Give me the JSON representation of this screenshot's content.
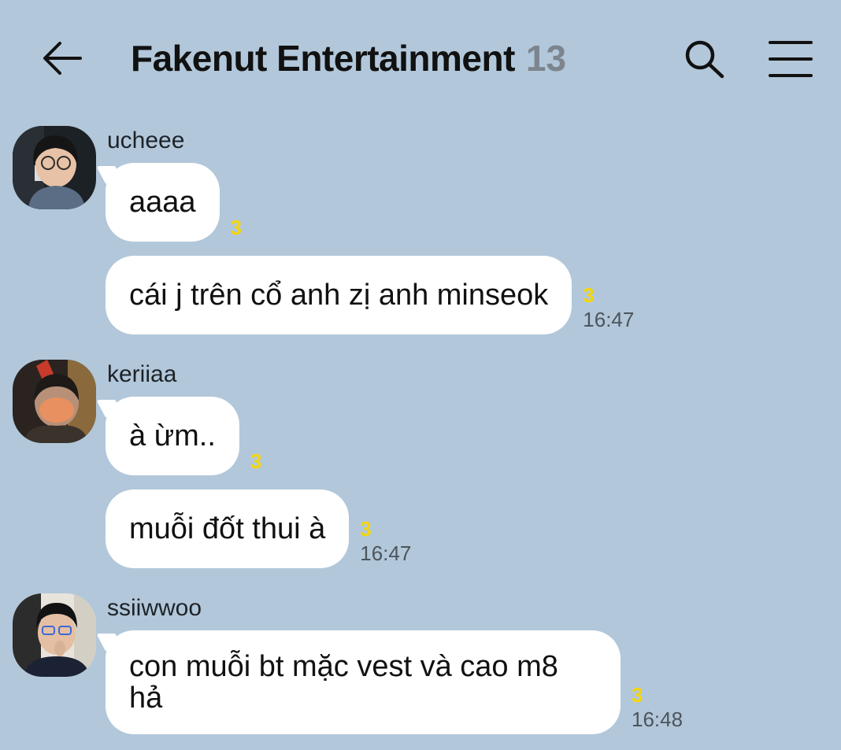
{
  "header": {
    "title": "Fakenut Entertainment",
    "member_count": "13"
  },
  "icons": {
    "back": "back-arrow-icon",
    "search": "search-icon",
    "menu": "menu-icon"
  },
  "colors": {
    "background": "#b2c7da",
    "bubble": "#ffffff",
    "unread": "#f5d60a",
    "member_count": "#7c858e"
  },
  "messages": [
    {
      "sender": "ucheee",
      "bubbles": [
        {
          "text": "aaaa",
          "unread": "3",
          "time": ""
        },
        {
          "text": "cái j trên cổ anh zị anh minseok",
          "unread": "3",
          "time": "16:47"
        }
      ]
    },
    {
      "sender": "keriiaa",
      "bubbles": [
        {
          "text": "à ừm..",
          "unread": "3",
          "time": ""
        },
        {
          "text": "muỗi đốt thui à",
          "unread": "3",
          "time": "16:47"
        }
      ]
    },
    {
      "sender": "ssiiwwoo",
      "bubbles": [
        {
          "text": "con muỗi bt mặc vest và cao m8 hả",
          "unread": "3",
          "time": "16:48"
        }
      ]
    }
  ]
}
